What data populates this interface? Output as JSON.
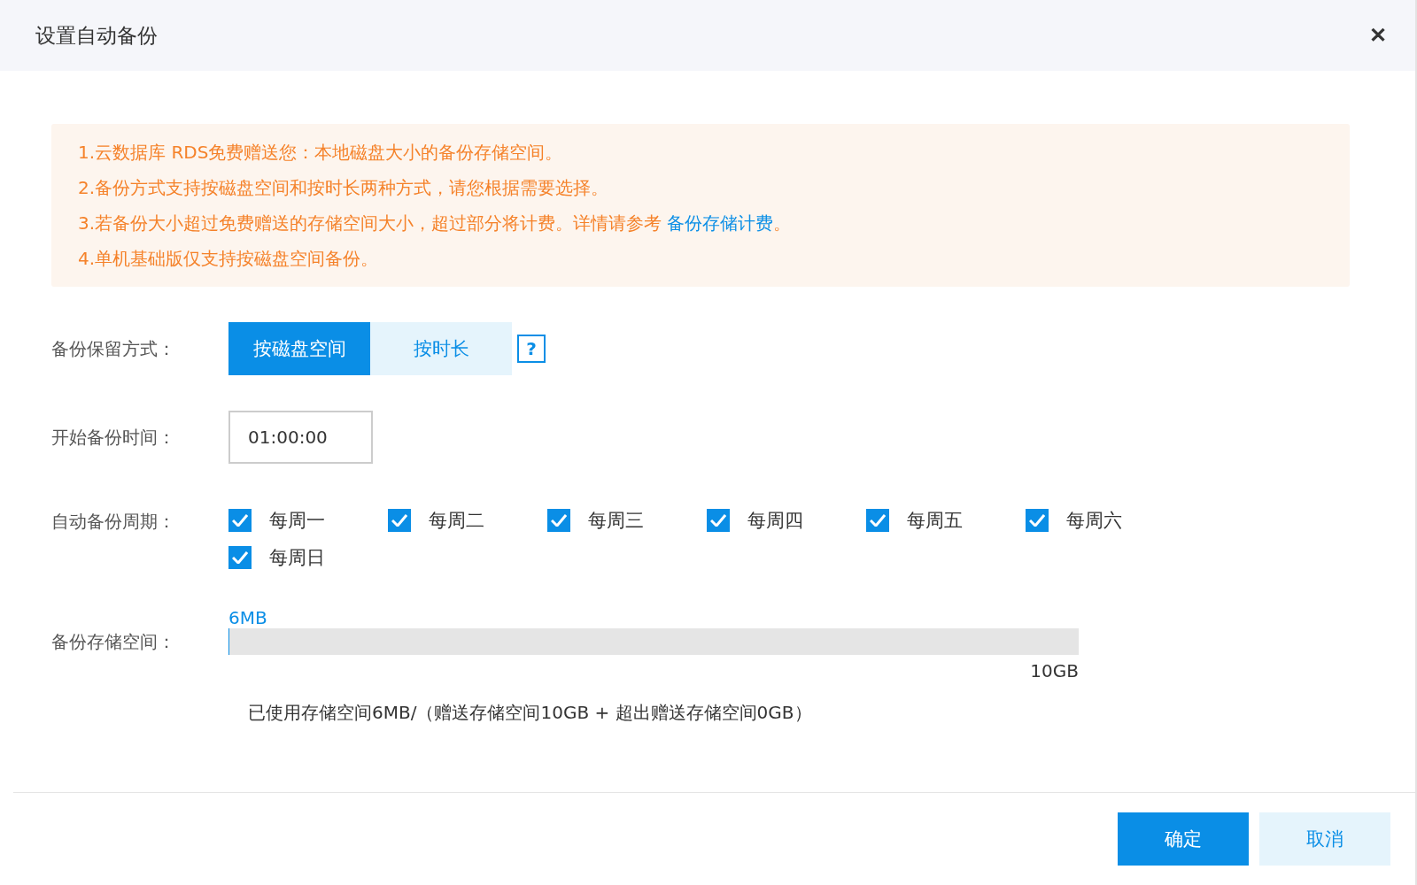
{
  "dialog": {
    "title": "设置自动备份",
    "close": "✕"
  },
  "notice": {
    "lines": [
      {
        "text": "1.云数据库 RDS免费赠送您：本地磁盘大小的备份存储空间。"
      },
      {
        "text": "2.备份方式支持按磁盘空间和按时长两种方式，请您根据需要选择。"
      },
      {
        "text": "3.若备份大小超过免费赠送的存储空间大小，超过部分将计费。详情请参考 ",
        "link": "备份存储计费",
        "after": "。"
      },
      {
        "text": "4.单机基础版仅支持按磁盘空间备份。"
      }
    ]
  },
  "retention": {
    "label": "备份保留方式：",
    "options": [
      {
        "label": "按磁盘空间",
        "selected": true
      },
      {
        "label": "按时长",
        "selected": false
      }
    ],
    "help": "?"
  },
  "start_time": {
    "label": "开始备份时间：",
    "value": "01:00:00"
  },
  "cycle": {
    "label": "自动备份周期：",
    "days": [
      {
        "label": "每周一",
        "checked": true
      },
      {
        "label": "每周二",
        "checked": true
      },
      {
        "label": "每周三",
        "checked": true
      },
      {
        "label": "每周四",
        "checked": true
      },
      {
        "label": "每周五",
        "checked": true
      },
      {
        "label": "每周六",
        "checked": true
      },
      {
        "label": "每周日",
        "checked": true
      }
    ]
  },
  "storage": {
    "label": "备份存储空间：",
    "used": "6MB",
    "level": 0.0006,
    "max": "10GB",
    "summary": "已使用存储空间6MB/（赠送存储空间10GB + 超出赠送存储空间0GB）"
  },
  "buttons": [
    {
      "label": "确定",
      "kind": "primary"
    },
    {
      "label": "取消",
      "kind": "secondary"
    }
  ]
}
